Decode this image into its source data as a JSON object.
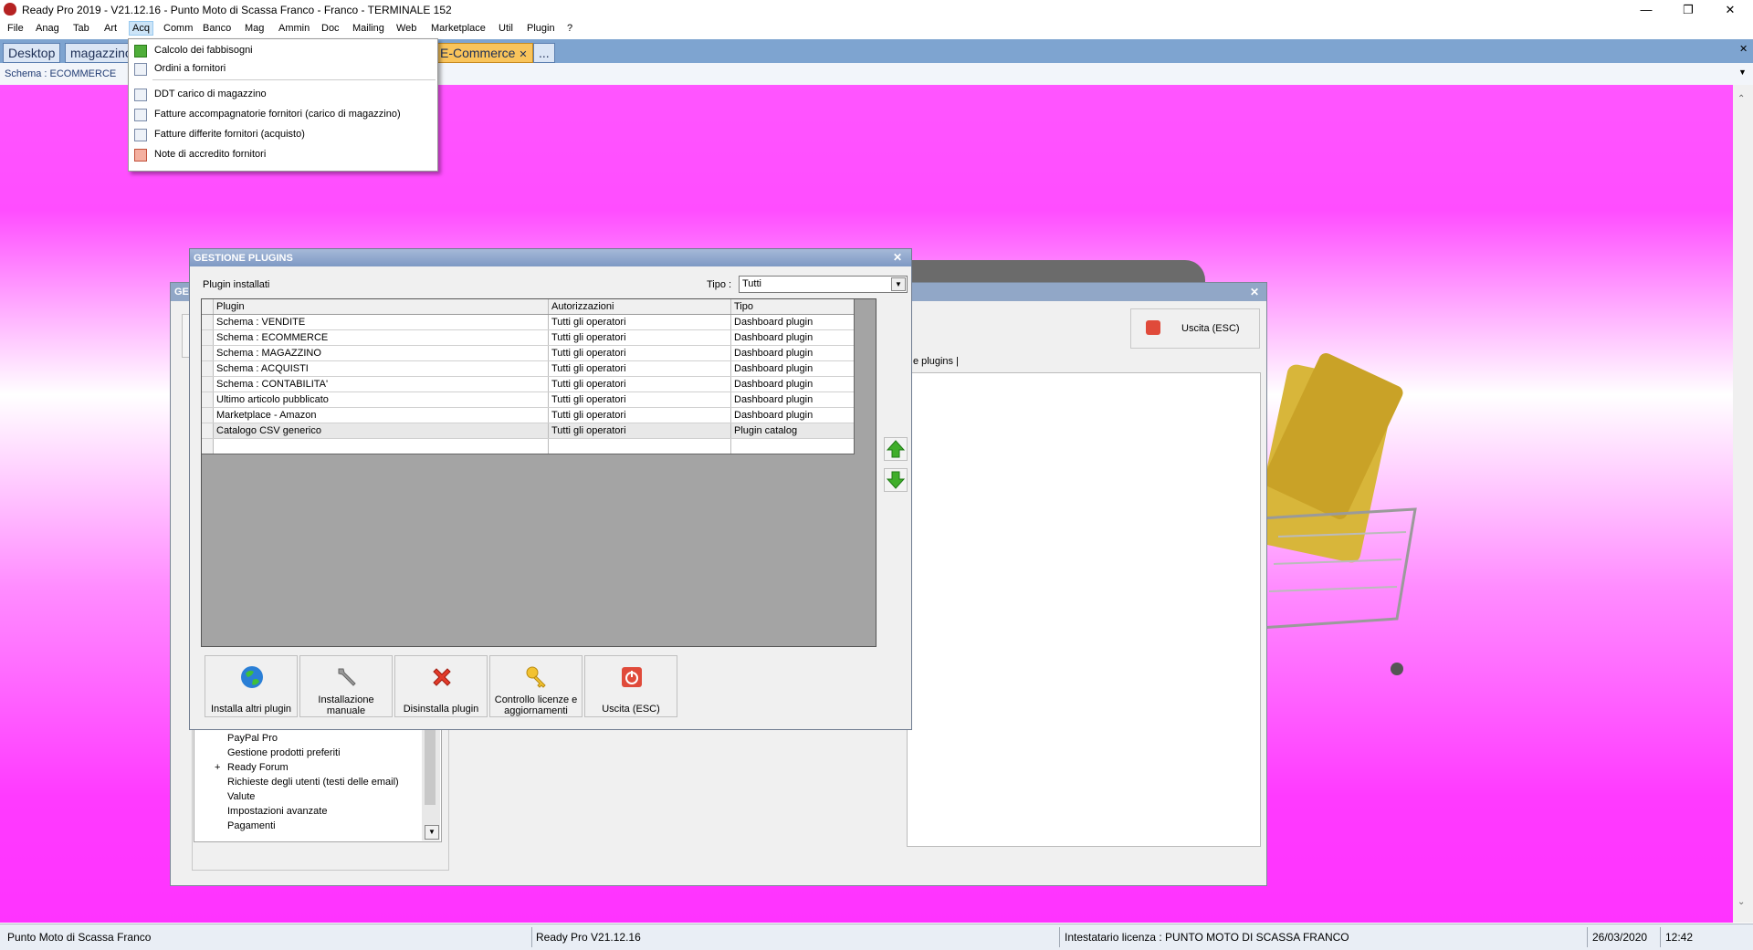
{
  "window": {
    "title": "Ready Pro 2019 - V21.12.16 - Punto Moto di Scassa Franco - Franco - TERMINALE 152",
    "controls": {
      "minimize": "—",
      "restore": "❐",
      "close": "✕"
    }
  },
  "menubar": [
    "File",
    "Anag",
    "Tab",
    "Art",
    "Acq",
    "Comm",
    "Banco",
    "Mag",
    "Ammin",
    "Doc",
    "Mailing",
    "Web",
    "Marketplace",
    "Util",
    "Plugin",
    "?"
  ],
  "tabs": [
    {
      "label": "Desktop"
    },
    {
      "label": "magazzino"
    },
    {
      "label": "E-Commerce",
      "close": "✕"
    },
    {
      "label": "..."
    }
  ],
  "schema_label": "Schema : ECOMMERCE",
  "acq_menu": [
    "Calcolo dei fabbisogni",
    "Ordini a fornitori",
    "DDT carico di magazzino",
    "Fatture accompagnatorie fornitori (carico di magazzino)",
    "Fatture differite fornitori (acquisto)",
    "Note di accredito fornitori"
  ],
  "back_window": {
    "title_fragment": "GE",
    "exit_button": "Uscita (ESC)",
    "tab_tail": "e plugins",
    "tree_items": [
      {
        "expander": "",
        "label": "PayPal Pro"
      },
      {
        "expander": "",
        "label": "Gestione prodotti preferiti"
      },
      {
        "expander": "+",
        "label": "Ready Forum"
      },
      {
        "expander": "",
        "label": "Richieste degli utenti (testi delle email)"
      },
      {
        "expander": "",
        "label": "Valute"
      },
      {
        "expander": "",
        "label": "Impostazioni avanzate"
      },
      {
        "expander": "",
        "label": "Pagamenti"
      }
    ]
  },
  "dialog": {
    "title": "GESTIONE PLUGINS",
    "section_label": "Plugin installati",
    "tipo_label": "Tipo :",
    "tipo_value": "Tutti",
    "columns": [
      "Plugin",
      "Autorizzazioni",
      "Tipo"
    ],
    "rows": [
      [
        "Schema : VENDITE",
        "Tutti gli operatori",
        "Dashboard plugin"
      ],
      [
        "Schema : ECOMMERCE",
        "Tutti gli operatori",
        "Dashboard plugin"
      ],
      [
        "Schema : MAGAZZINO",
        "Tutti gli operatori",
        "Dashboard plugin"
      ],
      [
        "Schema : ACQUISTI",
        "Tutti gli operatori",
        "Dashboard plugin"
      ],
      [
        "Schema : CONTABILITA'",
        "Tutti gli operatori",
        "Dashboard plugin"
      ],
      [
        "Ultimo articolo pubblicato",
        "Tutti gli operatori",
        "Dashboard plugin"
      ],
      [
        "Marketplace - Amazon",
        "Tutti gli operatori",
        "Dashboard plugin"
      ],
      [
        "Catalogo CSV generico",
        "Tutti gli operatori",
        "Plugin catalog"
      ]
    ],
    "buttons": {
      "install_more": "Installa altri plugin",
      "manual_install_1": "Installazione",
      "manual_install_2": "manuale",
      "uninstall": "Disinstalla plugin",
      "licenses_1": "Controllo licenze e",
      "licenses_2": "aggiornamenti",
      "exit": "Uscita (ESC)"
    }
  },
  "statusbar": {
    "company": "Punto Moto di Scassa Franco",
    "version": "Ready Pro V21.12.16",
    "license": "Intestatario licenza : PUNTO MOTO DI SCASSA FRANCO",
    "date": "26/03/2020",
    "time": "12:42"
  },
  "colors": {
    "accent": "#7ea4d0",
    "active_tab": "#f9c45b",
    "background_magenta": "#ff44ff",
    "dialog_title": "#8ea6cc"
  }
}
